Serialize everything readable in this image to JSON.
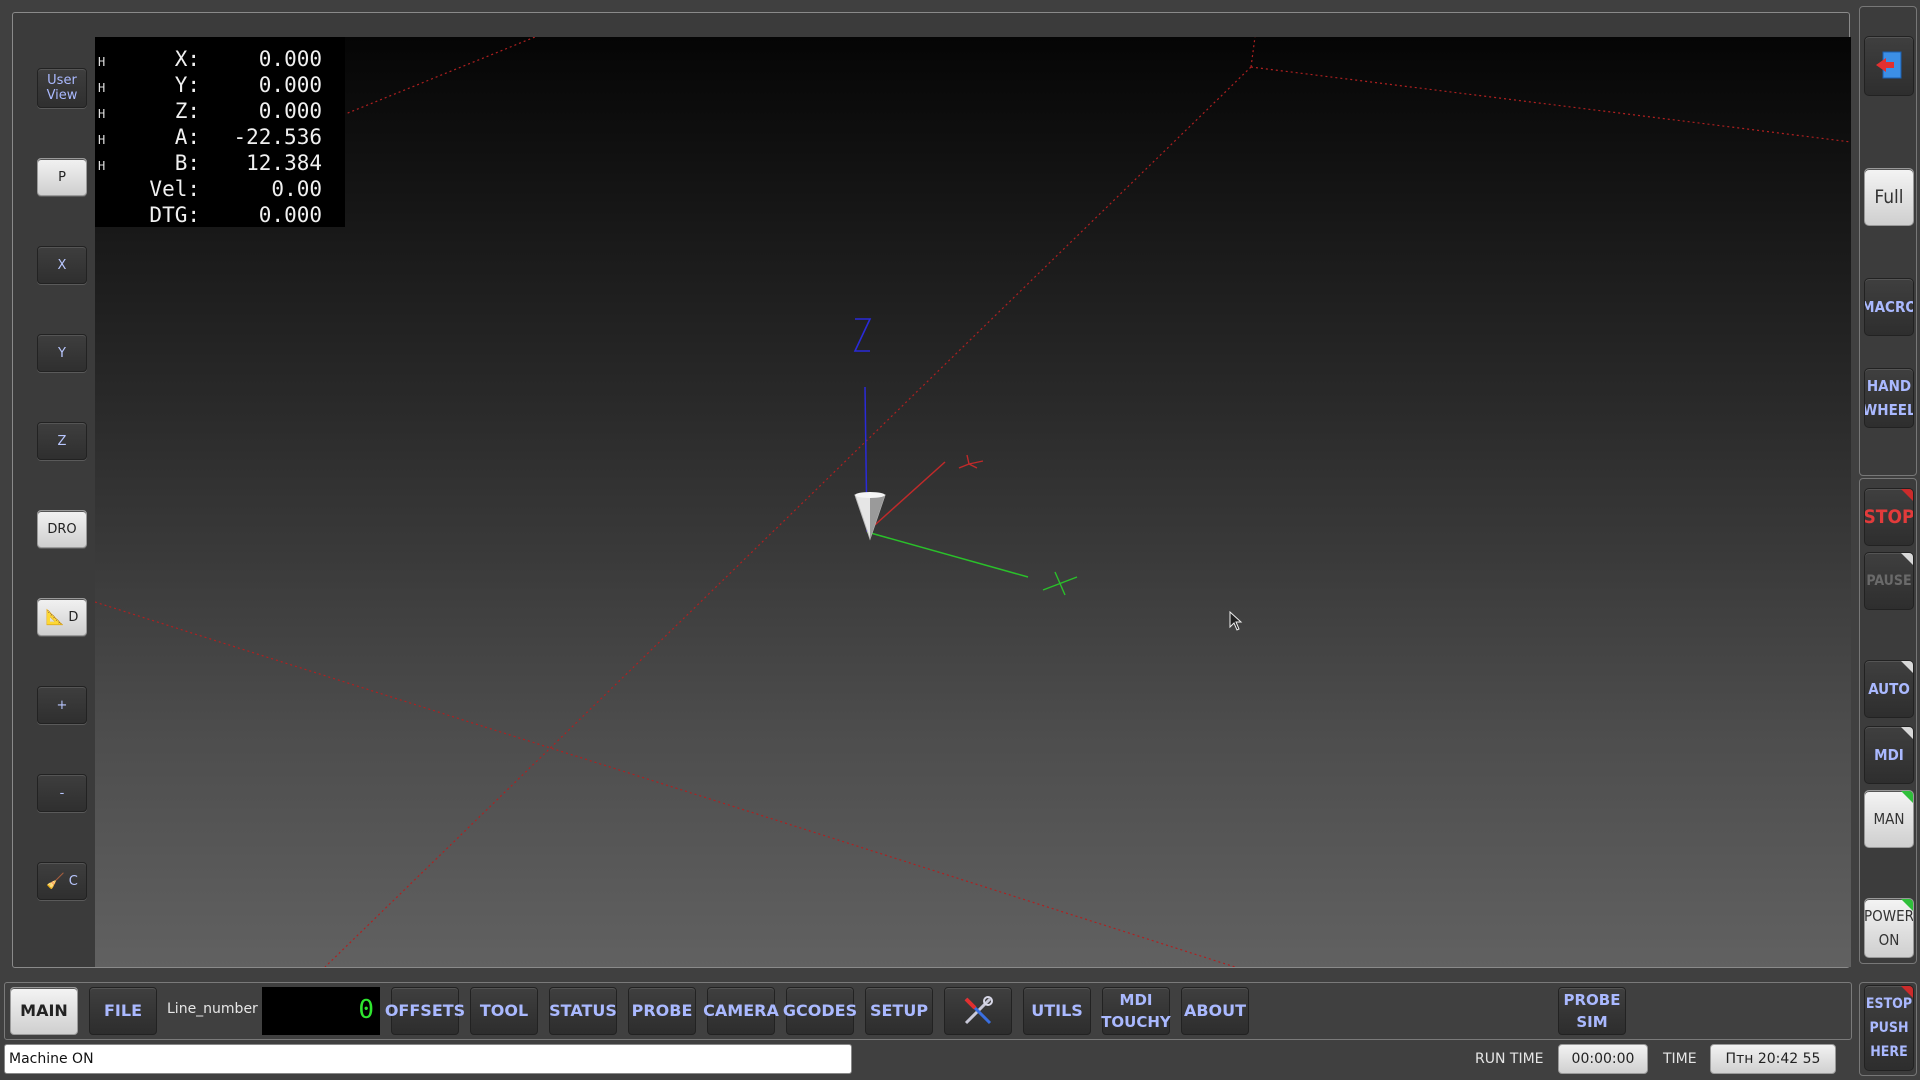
{
  "dro": {
    "rows": [
      {
        "flag": "H",
        "label": "X:",
        "value": "0.000"
      },
      {
        "flag": "H",
        "label": "Y:",
        "value": "0.000"
      },
      {
        "flag": "H",
        "label": "Z:",
        "value": "0.000"
      },
      {
        "flag": "H",
        "label": "A:",
        "value": "-22.536"
      },
      {
        "flag": "H",
        "label": "B:",
        "value": "12.384"
      },
      {
        "flag": "",
        "label": "Vel:",
        "value": "0.00"
      },
      {
        "flag": "",
        "label": "DTG:",
        "value": "0.000"
      }
    ]
  },
  "axes": {
    "x": "X",
    "y": "Y",
    "z": "Z"
  },
  "left_toolbar": {
    "user_view": "User View",
    "p": "P",
    "x": "X",
    "y": "Y",
    "z": "Z",
    "dro": "DRO",
    "d": "D",
    "plus": "+",
    "minus": "-",
    "c": "C"
  },
  "right_toolbar": {
    "full": "Full",
    "macro": "MACRO",
    "hand_wheel": "HAND WHEEL",
    "stop": "STOP",
    "pause": "PAUSE",
    "auto": "AUTO",
    "mdi": "MDI",
    "man": "MAN",
    "power_on": "POWER ON",
    "estop": "ESTOP PUSH HERE"
  },
  "tabs": {
    "main": "MAIN",
    "file": "FILE",
    "offsets": "OFFSETS",
    "tool": "TOOL",
    "status": "STATUS",
    "probe": "PROBE",
    "camera": "CAMERA",
    "gcodes": "GCODES",
    "setup": "SETUP",
    "utils": "UTILS",
    "mdi_touchy": "MDI TOUCHY",
    "about": "ABOUT",
    "probe_sim": "PROBE SIM"
  },
  "line": {
    "label": "Line_number",
    "value": "0"
  },
  "status": {
    "message": "Machine ON",
    "run_time_label": "RUN TIME",
    "run_time": "00:00:00",
    "time_label": "TIME",
    "time": "Птн 20:42 55"
  },
  "colors": {
    "accent_text": "#aab9ff",
    "stop": "#e23b3b",
    "indicator_green": "#2fbf3a",
    "indicator_red": "#cc2b2b",
    "line_number": "#2fe62f"
  }
}
